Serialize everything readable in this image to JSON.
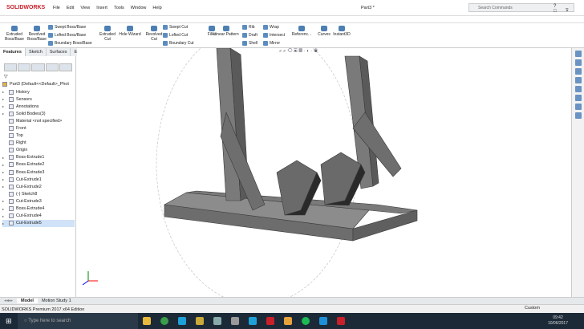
{
  "app": {
    "logo": "SOLIDWORKS",
    "doc_title": "Part3 *",
    "search_placeholder": "Search Commands"
  },
  "menu": [
    "File",
    "Edit",
    "View",
    "Insert",
    "Tools",
    "Window",
    "Help"
  ],
  "ribbon": {
    "big": [
      "Extruded Boss/Base",
      "Revolved Boss/Base",
      "Extruded Cut",
      "Hole Wizard",
      "Revolved Cut",
      "Fillet",
      "Linear Pattern",
      "Referenc...",
      "Curves",
      "Instant3D"
    ],
    "small1": [
      "Swept Boss/Base",
      "Lofted Boss/Base",
      "Boundary Boss/Base"
    ],
    "small2": [
      "Swept Cut",
      "Lofted Cut",
      "Boundary Cut"
    ],
    "small3": [
      "Rib",
      "Draft",
      "Shell"
    ],
    "small4": [
      "Wrap",
      "Intersect",
      "Mirror"
    ]
  },
  "tabs": [
    "Features",
    "Sketch",
    "Surfaces",
    "Evaluate",
    "DimXpert",
    "SOLIDWORKS Add-Ins"
  ],
  "tree": {
    "root": "Part3  (Default<<Default>_Phot",
    "items": [
      "History",
      "Sensors",
      "Annotations",
      "Solid Bodies(3)",
      "Material <not specified>",
      "Front",
      "Top",
      "Right",
      "Origin",
      "Boss-Extrude1",
      "Boss-Extrude2",
      "Boss-Extrude3",
      "Cut-Extrude1",
      "Cut-Extrude2",
      "(-) Sketch8",
      "Cut-Extrude3",
      "Boss-Extrude4",
      "Cut-Extrude4",
      "Cut-Extrude5"
    ],
    "selected": "Cut-Extrude5"
  },
  "bottom_tabs": [
    "Model",
    "Motion Study 1"
  ],
  "status": {
    "text": "SOLIDWORKS Premium 2017 x64 Edition",
    "units": "Custom"
  },
  "taskbar": {
    "search": "Type here to search",
    "time": "09:42",
    "date": "10/06/2017"
  },
  "colors": {
    "model": "#707070",
    "brand": "#c8202a",
    "taskbar": "#1c2a38"
  }
}
